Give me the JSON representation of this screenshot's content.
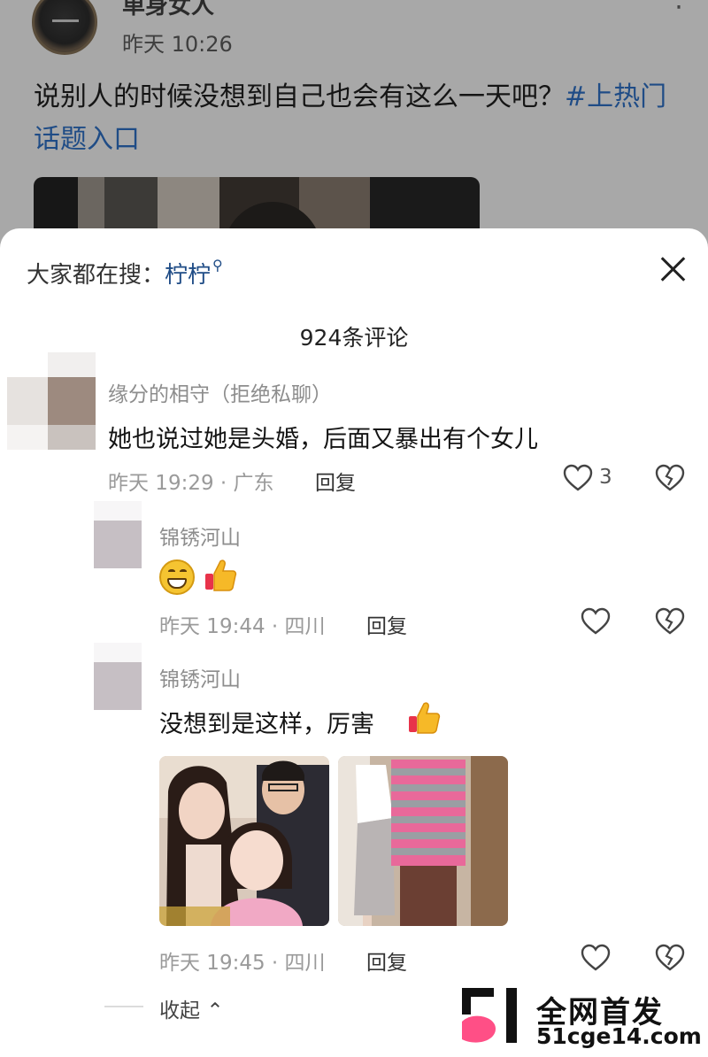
{
  "post": {
    "author": "单身女人",
    "time": "昨天 10:26",
    "more_icon": "more-icon",
    "text": "说别人的时候没想到自己也会有这么一天吧？",
    "hashtag": "#上热门话题入口"
  },
  "sheet": {
    "search_prefix": "大家都在搜：",
    "search_term": "柠柠",
    "comment_count": "924条评论",
    "close_icon": "close-icon"
  },
  "comments": [
    {
      "name": "缘分的相守（拒绝私聊）",
      "text": "她也说过她是头婚，后面又暴出有个女儿",
      "meta": "昨天 19:29 · 广东",
      "reply": "回复",
      "likes": "3"
    },
    {
      "name": "锦锈河山",
      "text": "",
      "meta": "昨天 19:44 · 四川",
      "reply": "回复",
      "emojis": [
        "grin-emoji",
        "thumbs-up-emoji"
      ]
    },
    {
      "name": "锦锈河山",
      "text": "没想到是这样，厉害",
      "meta": "昨天 19:45 · 四川",
      "reply": "回复",
      "emojis": [
        "thumbs-up-emoji"
      ]
    }
  ],
  "collapse_label": "收起",
  "watermark": {
    "title": "全网首发",
    "url": "51cge14.com"
  },
  "colors": {
    "link": "#1f4c86",
    "overlay": "#a8a8a8",
    "watermark_pink": "#ff4f86"
  }
}
